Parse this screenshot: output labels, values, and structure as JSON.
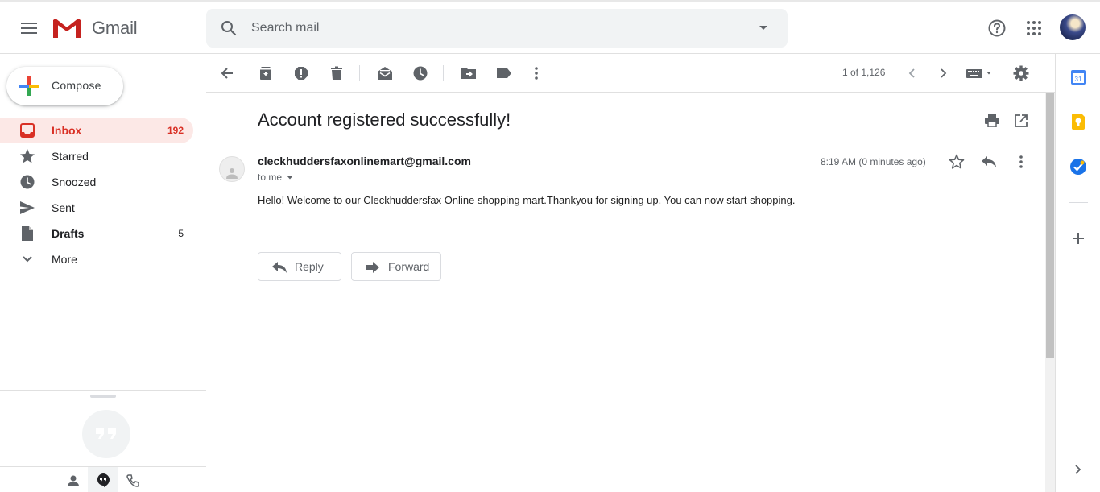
{
  "header": {
    "app_name": "Gmail",
    "search_placeholder": "Search mail"
  },
  "sidebar": {
    "compose_label": "Compose",
    "items": [
      {
        "label": "Inbox",
        "count": "192",
        "icon": "inbox-icon",
        "active": true
      },
      {
        "label": "Starred",
        "count": "",
        "icon": "star-icon"
      },
      {
        "label": "Snoozed",
        "count": "",
        "icon": "clock-icon"
      },
      {
        "label": "Sent",
        "count": "",
        "icon": "send-icon"
      },
      {
        "label": "Drafts",
        "count": "5",
        "icon": "draft-icon"
      },
      {
        "label": "More",
        "count": "",
        "icon": "chevron-down-icon"
      }
    ]
  },
  "toolbar": {
    "pager": "1 of 1,126"
  },
  "message": {
    "subject": "Account registered successfully!",
    "sender": "cleckhuddersfaxonlinemart@gmail.com",
    "recipient": "to me",
    "timestamp": "8:19 AM (0 minutes ago)",
    "body": "Hello! Welcome to our Cleckhuddersfax Online shopping mart.Thankyou for signing up. You can now start shopping.",
    "reply_label": "Reply",
    "forward_label": "Forward"
  },
  "side_panel": {
    "calendar_day": "31"
  },
  "colors": {
    "accent_red": "#d93025",
    "active_bg": "#fce8e6",
    "icon_gray": "#5f6368"
  }
}
